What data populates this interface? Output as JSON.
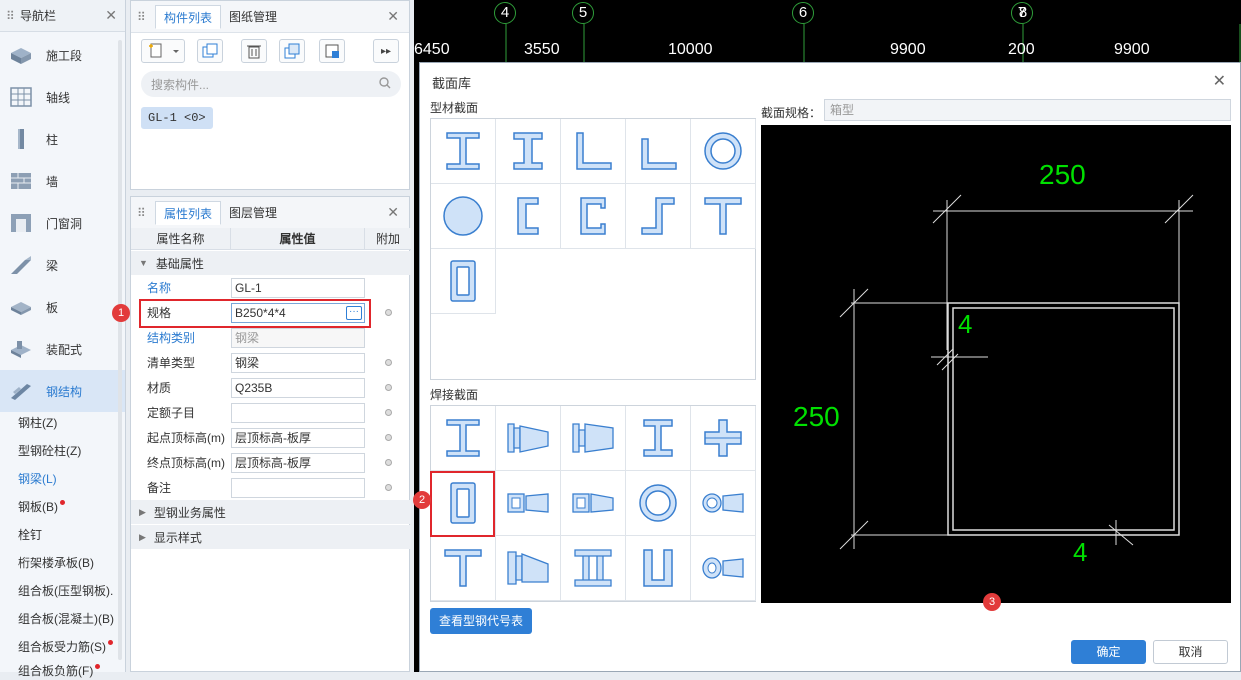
{
  "nav": {
    "title": "导航栏",
    "items": [
      {
        "label": "施工段",
        "icon": "construction-section-icon"
      },
      {
        "label": "轴线",
        "icon": "axis-grid-icon"
      },
      {
        "label": "柱",
        "icon": "column-icon"
      },
      {
        "label": "墙",
        "icon": "wall-icon"
      },
      {
        "label": "门窗洞",
        "icon": "door-window-icon"
      },
      {
        "label": "梁",
        "icon": "beam-icon"
      },
      {
        "label": "板",
        "icon": "slab-icon"
      },
      {
        "label": "装配式",
        "icon": "prefab-icon"
      },
      {
        "label": "钢结构",
        "icon": "steel-structure-icon"
      }
    ],
    "sub_items": [
      {
        "label": "钢柱(Z)"
      },
      {
        "label": "型钢砼柱(Z)"
      },
      {
        "label": "钢梁(L)"
      },
      {
        "label": "钢板(B)"
      },
      {
        "label": "栓钉"
      },
      {
        "label": "桁架楼承板(B)"
      },
      {
        "label": "组合板(压型钢板)."
      },
      {
        "label": "组合板(混凝土)(B)"
      },
      {
        "label": "组合板受力筋(S)"
      },
      {
        "label": "组合板负筋(F)"
      }
    ]
  },
  "component_panel": {
    "tabs": [
      "构件列表",
      "图纸管理"
    ],
    "search_placeholder": "搜索构件...",
    "items": [
      "GL-1 <0>"
    ]
  },
  "property_panel": {
    "tabs": [
      "属性列表",
      "图层管理"
    ],
    "headers": [
      "属性名称",
      "属性值",
      "附加"
    ],
    "group_basic": "基础属性",
    "rows": [
      {
        "name": "名称",
        "value": "GL-1"
      },
      {
        "name": "规格",
        "value": "B250*4*4"
      },
      {
        "name": "结构类别",
        "value": "钢梁"
      },
      {
        "name": "清单类型",
        "value": "钢梁"
      },
      {
        "name": "材质",
        "value": "Q235B"
      },
      {
        "name": "定额子目",
        "value": ""
      },
      {
        "name": "起点顶标高(m)",
        "value": "层顶标高-板厚"
      },
      {
        "name": "终点顶标高(m)",
        "value": "层顶标高-板厚"
      },
      {
        "name": "备注",
        "value": ""
      }
    ],
    "group_business": "型钢业务属性",
    "group_display": "显示样式"
  },
  "cad": {
    "axis_numbers": [
      "4",
      "5",
      "6",
      "7",
      "8"
    ],
    "dims": [
      "6450",
      "3550",
      "10000",
      "9900",
      "200",
      "9900"
    ]
  },
  "dialog": {
    "title": "截面库",
    "section_profile": "型材截面",
    "section_welded": "焊接截面",
    "spec_label": "截面规格：",
    "spec_value": "箱型",
    "preview": {
      "width": "250",
      "height": "250",
      "thk1": "4",
      "thk2": "4"
    },
    "view_code_table": "查看型钢代号表",
    "ok": "确定",
    "cancel": "取消"
  },
  "annotations": [
    "1",
    "2",
    "3"
  ],
  "colors": {
    "accent": "#2f7fd6",
    "highlight": "#e0262c",
    "cad_green": "#00e000"
  }
}
